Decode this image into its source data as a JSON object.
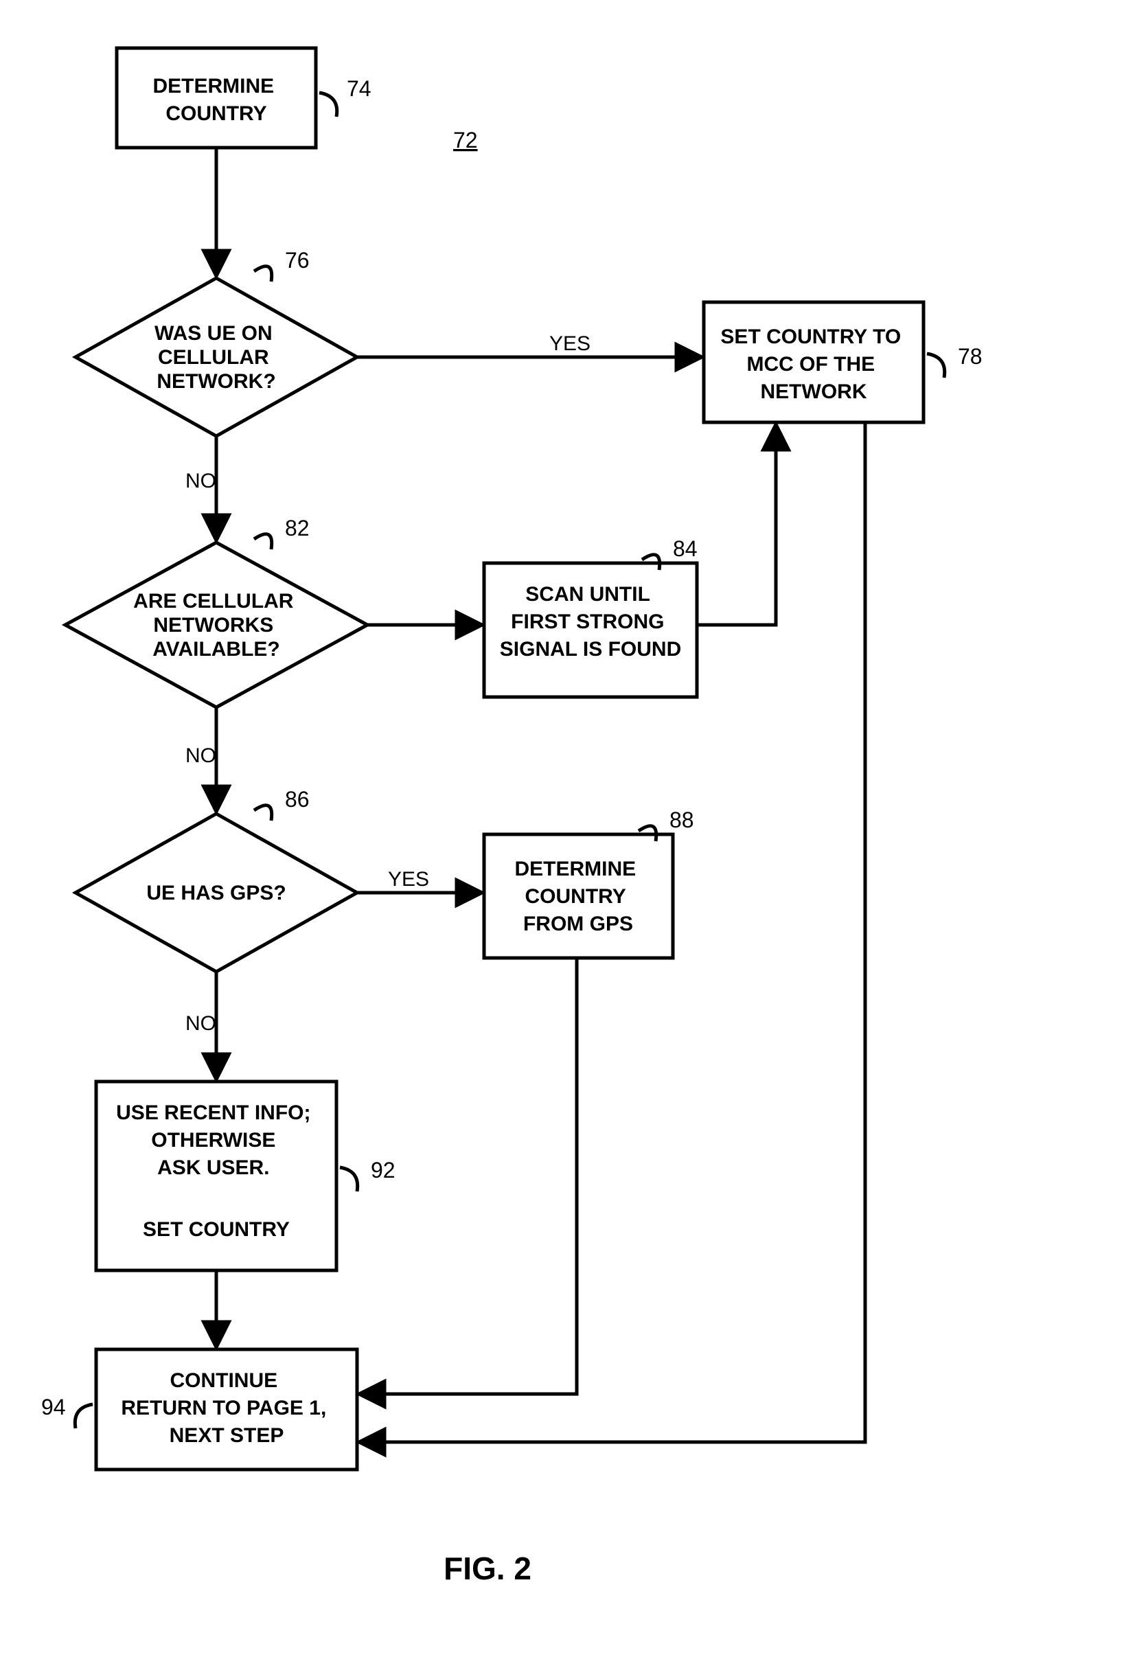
{
  "figure_label": "FIG. 2",
  "ref_diagram": "72",
  "nodes": {
    "n74": {
      "ref": "74",
      "lines": [
        "DETERMINE",
        "COUNTRY"
      ]
    },
    "n76": {
      "ref": "76",
      "lines": [
        "WAS UE ON",
        "CELLULAR",
        "NETWORK?"
      ]
    },
    "n78": {
      "ref": "78",
      "lines": [
        "SET COUNTRY TO",
        "MCC OF THE",
        "NETWORK"
      ]
    },
    "n82": {
      "ref": "82",
      "lines": [
        "ARE CELLULAR",
        "NETWORKS",
        "AVAILABLE?"
      ]
    },
    "n84": {
      "ref": "84",
      "lines": [
        "SCAN UNTIL",
        "FIRST STRONG",
        "SIGNAL IS FOUND"
      ]
    },
    "n86": {
      "ref": "86",
      "lines": [
        "UE HAS GPS?"
      ]
    },
    "n88": {
      "ref": "88",
      "lines": [
        "DETERMINE",
        "COUNTRY",
        "FROM GPS"
      ]
    },
    "n92": {
      "ref": "92",
      "lines": [
        "USE RECENT INFO;",
        "OTHERWISE",
        "ASK USER.",
        "",
        "SET COUNTRY"
      ]
    },
    "n94": {
      "ref": "94",
      "lines": [
        "CONTINUE",
        "RETURN TO PAGE 1,",
        "NEXT STEP"
      ]
    }
  },
  "edges": {
    "e76_yes": "YES",
    "e76_no": "NO",
    "e82_no": "NO",
    "e86_yes": "YES",
    "e86_no": "NO"
  },
  "chart_data": {
    "type": "flowchart",
    "title": "FIG. 2",
    "reference_numeral": "72",
    "nodes": [
      {
        "id": "74",
        "shape": "process",
        "text": "DETERMINE COUNTRY"
      },
      {
        "id": "76",
        "shape": "decision",
        "text": "WAS UE ON CELLULAR NETWORK?"
      },
      {
        "id": "78",
        "shape": "process",
        "text": "SET COUNTRY TO MCC OF THE NETWORK"
      },
      {
        "id": "82",
        "shape": "decision",
        "text": "ARE CELLULAR NETWORKS AVAILABLE?"
      },
      {
        "id": "84",
        "shape": "process",
        "text": "SCAN UNTIL FIRST STRONG SIGNAL IS FOUND"
      },
      {
        "id": "86",
        "shape": "decision",
        "text": "UE HAS GPS?"
      },
      {
        "id": "88",
        "shape": "process",
        "text": "DETERMINE COUNTRY FROM GPS"
      },
      {
        "id": "92",
        "shape": "process",
        "text": "USE RECENT INFO; OTHERWISE ASK USER. SET COUNTRY"
      },
      {
        "id": "94",
        "shape": "process",
        "text": "CONTINUE RETURN TO PAGE 1, NEXT STEP"
      }
    ],
    "edges": [
      {
        "from": "74",
        "to": "76",
        "label": ""
      },
      {
        "from": "76",
        "to": "78",
        "label": "YES"
      },
      {
        "from": "76",
        "to": "82",
        "label": "NO"
      },
      {
        "from": "82",
        "to": "84",
        "label": ""
      },
      {
        "from": "82",
        "to": "86",
        "label": "NO"
      },
      {
        "from": "84",
        "to": "78",
        "label": ""
      },
      {
        "from": "86",
        "to": "88",
        "label": "YES"
      },
      {
        "from": "86",
        "to": "92",
        "label": "NO"
      },
      {
        "from": "88",
        "to": "94",
        "label": ""
      },
      {
        "from": "92",
        "to": "94",
        "label": ""
      },
      {
        "from": "78",
        "to": "94",
        "label": ""
      }
    ]
  }
}
